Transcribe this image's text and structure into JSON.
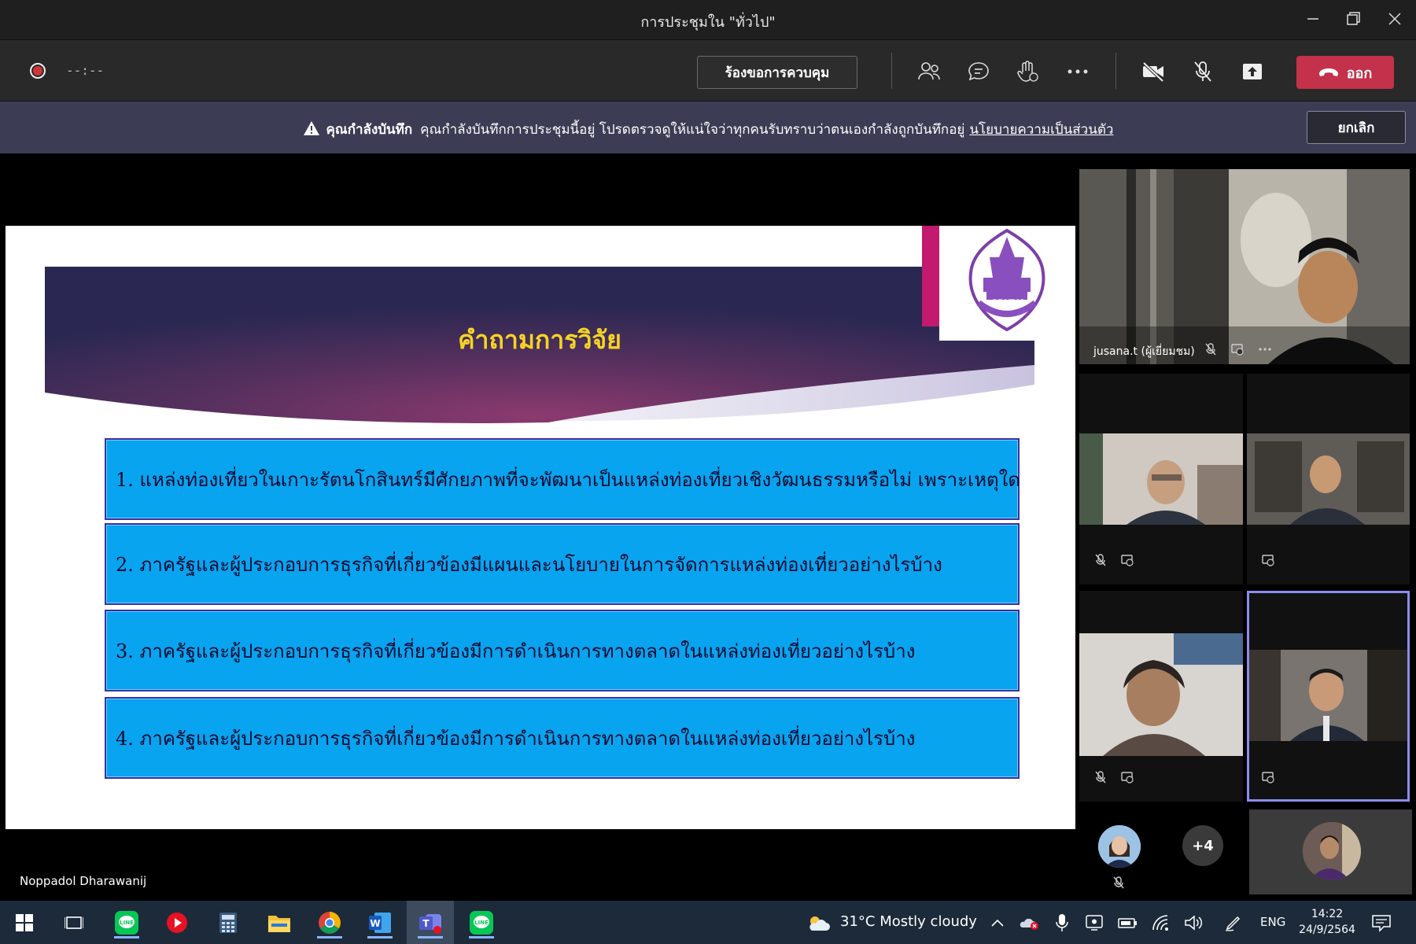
{
  "window": {
    "title": "การประชุมใน \"ทั่วไป\"",
    "minimize_icon": "minimize-icon",
    "maximize_icon": "restore-icon",
    "close_icon": "close-icon"
  },
  "controls": {
    "timer": "--:--",
    "request_control_label": "ร้องขอการควบคุม",
    "leave_label": "ออก",
    "icons": [
      "participants-icon",
      "chat-icon",
      "raise-hand-icon",
      "more-options-icon",
      "camera-off-icon",
      "mic-off-icon",
      "share-tray-icon",
      "phone-hangup-icon"
    ],
    "leave_color": "#c4314b"
  },
  "banner": {
    "bold_text": "คุณกำลังบันทึก",
    "message": "คุณกำลังบันทึกการประชุมนี้อยู่ โปรดตรวจดูให้แน่ใจว่าทุกคนรับทราบว่าตนเองกำลังถูกบันทึกอยู่",
    "link_text": "นโยบายความเป็นส่วนตัว",
    "cancel_label": "ยกเลิก",
    "background": "#3c3d54"
  },
  "slide": {
    "title": "คำถามการวิจัย",
    "title_color": "#f5d423",
    "box_color": "#08a4f0",
    "questions": [
      "1. แหล่งท่องเที่ยวในเกาะรัตนโกสินทร์มีศักยภาพที่จะพัฒนาเป็นแหล่งท่องเที่ยวเชิงวัฒนธรรมหรือไม่  เพราะเหตุใด",
      "2. ภาครัฐและผู้ประกอบการธุรกิจที่เกี่ยวข้องมีแผนและนโยบายในการจัดการแหล่งท่องเที่ยวอย่างไรบ้าง",
      "3. ภาครัฐและผู้ประกอบการธุรกิจที่เกี่ยวข้องมีการดำเนินการทางตลาดในแหล่งท่องเที่ยวอย่างไรบ้าง",
      "4. ภาครัฐและผู้ประกอบการธุรกิจที่เกี่ยวข้องมีการดำเนินการทางตลาดในแหล่งท่องเที่ยวอย่างไรบ้าง"
    ],
    "presenter": "Noppadol Dharawanij"
  },
  "participants": {
    "featured_name": "jusana.t (ผู้เยี่ยมชม)",
    "overflow_count": "+4",
    "active_speaker_border": "#8b8cf0"
  },
  "taskbar": {
    "weather": "31°C  Mostly cloudy",
    "language": "ENG",
    "time": "14:22",
    "date": "24/9/2564",
    "apps": [
      "windows-start-icon",
      "task-view-icon",
      "line-app-icon",
      "video-player-icon",
      "calculator-icon",
      "file-explorer-icon",
      "chrome-icon",
      "word-icon",
      "teams-icon",
      "line-app-icon"
    ]
  }
}
